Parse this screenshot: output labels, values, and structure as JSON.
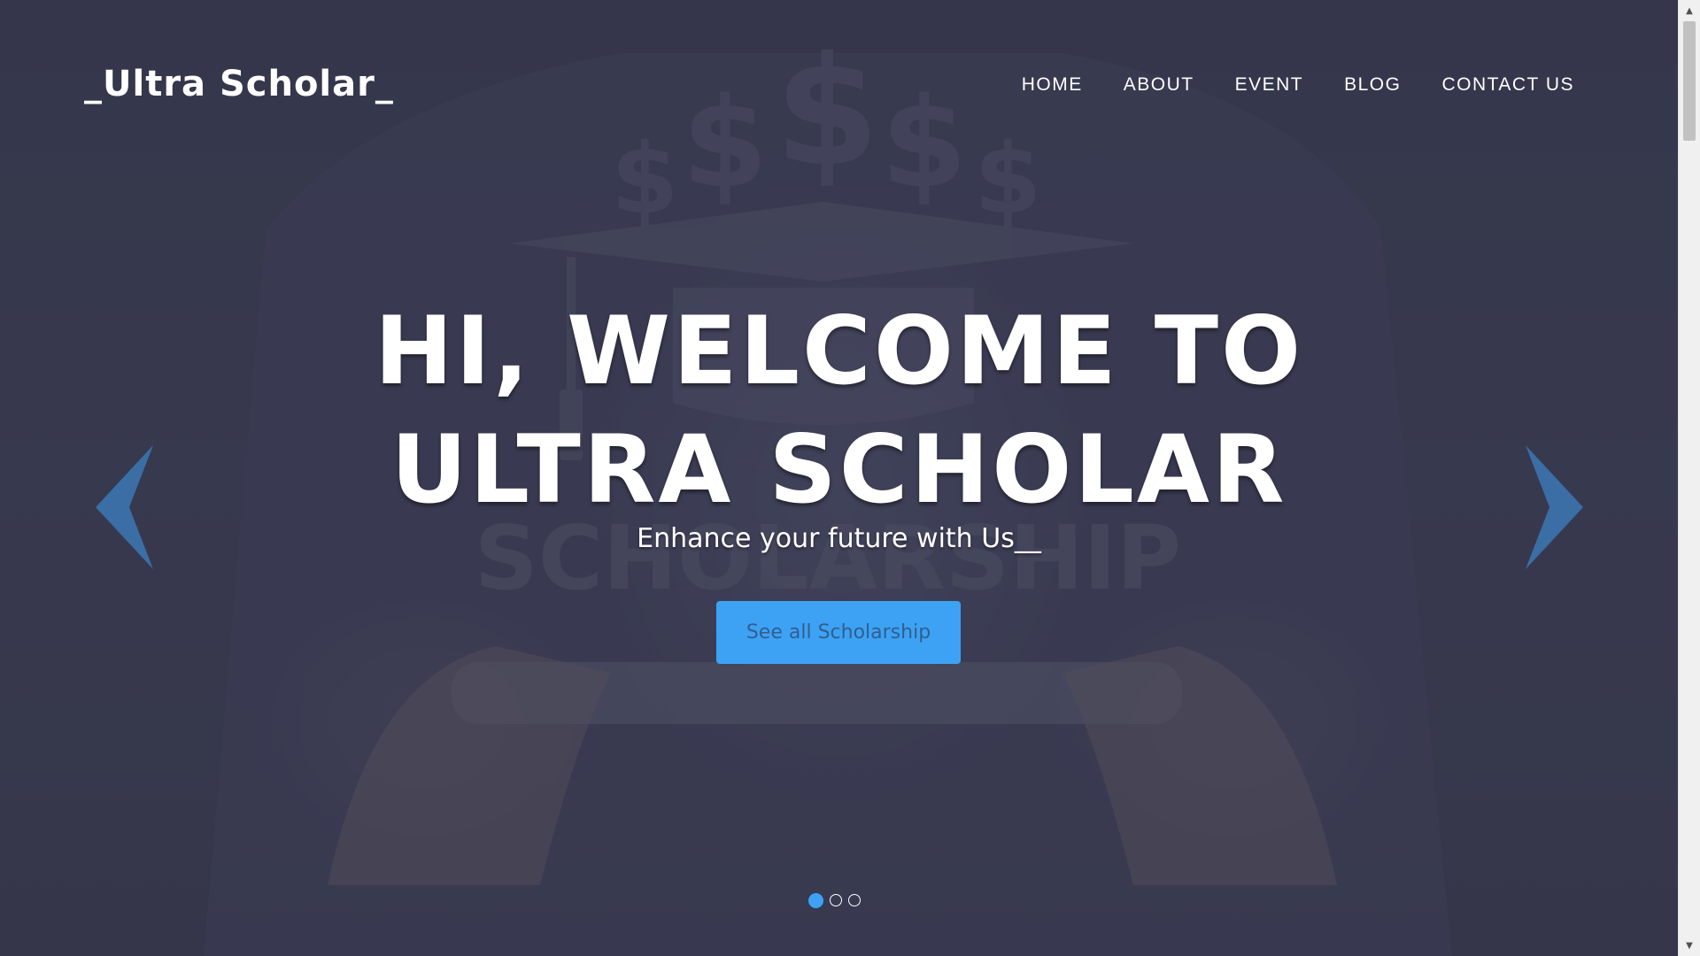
{
  "header": {
    "logo": "_Ultra Scholar_",
    "nav": [
      "HOME",
      "ABOUT",
      "EVENT",
      "BLOG",
      "CONTACT US"
    ]
  },
  "hero": {
    "title": "HI, WELCOME TO ULTRA SCHOLAR",
    "subtitle": "Enhance your future with Us__",
    "cta_label": "See all Scholarship",
    "background_text": "SCHOLARSHIP",
    "background_symbol": "$"
  },
  "carousel": {
    "slide_count": 3,
    "active_index": 0,
    "prev_icon": "chevron-left-icon",
    "next_icon": "chevron-right-icon"
  },
  "scrollbar": {
    "up_glyph": "▲",
    "down_glyph": "▼"
  },
  "colors": {
    "accent": "#3ea2f4",
    "arrow": "#3a6ea5",
    "overlay": "#3a3b4e",
    "button_text": "#2f5f8f"
  }
}
